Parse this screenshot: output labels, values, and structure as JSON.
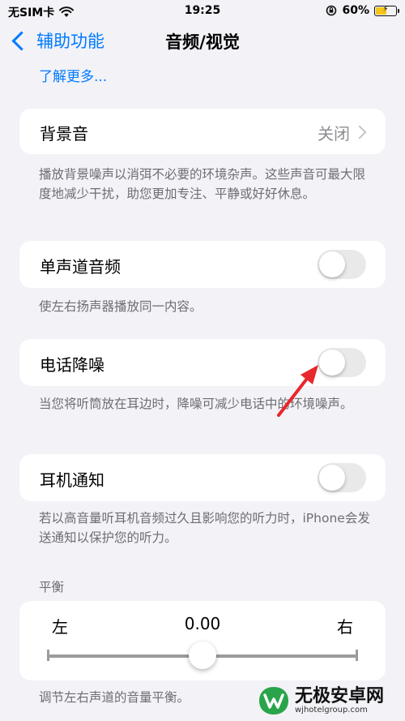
{
  "status_bar": {
    "carrier": "无SIM卡",
    "time": "19:25",
    "battery_percent": "60%",
    "battery_level": 0.6,
    "icons": [
      "wifi-icon",
      "orientation-lock-icon",
      "battery-icon"
    ]
  },
  "nav": {
    "back_label": "辅助功能",
    "title": "音频/视觉"
  },
  "learn_more": "了解更多...",
  "background_sounds": {
    "label": "背景音",
    "value": "关闭",
    "footnote": "播放背景噪声以消弭不必要的环境杂声。这些声音可最大限度地减少干扰，助您更加专注、平静或好好休息。"
  },
  "mono_audio": {
    "label": "单声道音频",
    "enabled": false,
    "footnote": "使左右扬声器播放同一内容。"
  },
  "phone_noise_cancellation": {
    "label": "电话降噪",
    "enabled": false,
    "footnote": "当您将听筒放在耳边时，降噪可减少电话中的环境噪声。"
  },
  "headphone_notifications": {
    "label": "耳机通知",
    "enabled": false,
    "footnote": "若以高音量听耳机音频过久且影响您的听力时，iPhone会发送通知以保护您的听力。"
  },
  "balance": {
    "section_header": "平衡",
    "left_label": "左",
    "right_label": "右",
    "value": "0.00",
    "position": 0.5,
    "footnote": "调节左右声道的音量平衡。"
  },
  "annotation": {
    "color": "#e8262b"
  },
  "watermark": {
    "name": "无极安卓网",
    "url": "wjhotelgroup.com"
  },
  "colors": {
    "accent": "#007aff",
    "background": "#f2f2f7",
    "toggle_off": "#e9e9ea",
    "battery": "#f5c518"
  }
}
